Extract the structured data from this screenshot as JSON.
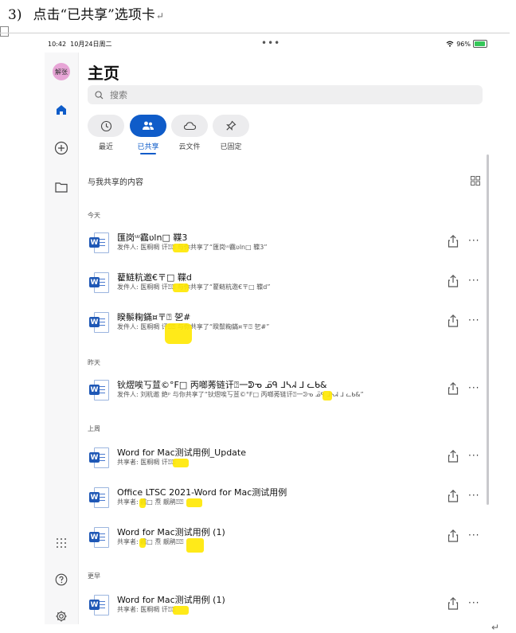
{
  "doc": {
    "number": "3)",
    "heading": "点击“已共享”选项卡",
    "return_mark": "↵",
    "end_mark": "↵"
  },
  "status": {
    "time": "10:42",
    "date": "10月24日周二",
    "battery": "96%",
    "battery_level": 0.96
  },
  "rail": {
    "avatar_initials": "解张",
    "items": [
      "home-icon",
      "add-icon",
      "folder-icon",
      "apps-icon",
      "help-icon",
      "settings-icon"
    ]
  },
  "main": {
    "title": "主页",
    "search_placeholder": "搜索",
    "tabs": [
      {
        "label": "最近",
        "icon": "clock-icon",
        "active": false
      },
      {
        "label": "已共享",
        "icon": "people-icon",
        "active": true
      },
      {
        "label": "云文件",
        "icon": "cloud-icon",
        "active": false
      },
      {
        "label": "已固定",
        "icon": "pin-icon",
        "active": false
      }
    ],
    "section_title": "与我共享的内容",
    "groups": [
      {
        "label": "今天"
      },
      {
        "label": "昨天"
      },
      {
        "label": "上周"
      },
      {
        "label": "更早"
      }
    ],
    "files": [
      {
        "name": "匯岗ᵚ靏ʋln□ 鞢3",
        "meta": "发件人: 医粡啁 讦⍰⍰ 与你共享了“匯岗ᵚ靏ʋln□ 鞢3”"
      },
      {
        "name": "藋鲢粇邀€〒□ 鞢d",
        "meta": "发件人: 医粡啁 讦⍰⍰ 与你共享了“藋鲢粇邀€〒□ 鞢d”"
      },
      {
        "name": "睽鬃粷鏋¤〒⍰ 乫#",
        "meta": "发件人: 医粡啁 讦⍰⍰ 与你共享了“睽鬃粷鏋¤〒⍰ 乫#”"
      },
      {
        "name": "钬熤唉丂荁©°F□ 丙啷莠链讦⍰一ᕲᓀ ᓄ̈̈ᑫ ᒧᓴᖽ ᒧ ᓚᑲ&",
        "meta": "发件人: 刘粇遨 銫ᵖ 与你共享了“钬熤唉丂荁©°F□ 丙啷莠链讦⍰一ᕲᓀ ᓄ̈̈ᑫ ᒧᓴᖽ ᒧ ᓚᑲ&”"
      },
      {
        "name": "Word for Mac测试用例_Update",
        "meta": "共享者: 医粡啁 讦⍰⍰"
      },
      {
        "name": "Office LTSC 2021-Word for Mac测试用例",
        "meta": "共享者: 靏□ 焘 靓鹃⍰⍰"
      },
      {
        "name": "Word for Mac测试用例 (1)",
        "meta": "共享者: 靏□ 焘 靓鹃⍰⍰"
      },
      {
        "name": "Word for Mac测试用例 (1)",
        "meta": "共享者: 医粡啁 讦⍰⍰"
      }
    ],
    "more_label": "···"
  },
  "colors": {
    "accent": "#0f5cc9",
    "word_blue": "#1f58b6",
    "highlight": "#ffe800",
    "avatar": "#e7a5d6"
  }
}
